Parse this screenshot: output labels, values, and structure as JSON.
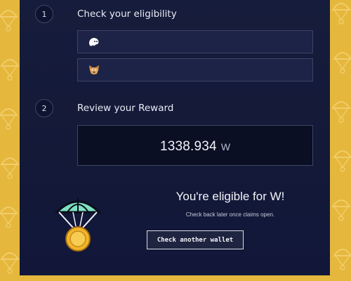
{
  "steps": [
    {
      "number": "1",
      "title": "Check your eligibility"
    },
    {
      "number": "2",
      "title": "Review your Reward"
    }
  ],
  "wallets": [
    {
      "icon": "phantom-ghost-icon"
    },
    {
      "icon": "metamask-fox-icon"
    }
  ],
  "reward": {
    "amount": "1338.934",
    "unit": "W"
  },
  "result": {
    "title": "You're eligible for W!",
    "subtitle": "Check back later once claims open.",
    "button_label": "Check another wallet"
  },
  "colors": {
    "background": "#e5b73c",
    "panel": "#161c3b",
    "accent_parachute": "#7ee0c0",
    "medal_gold": "#f1b52a"
  }
}
